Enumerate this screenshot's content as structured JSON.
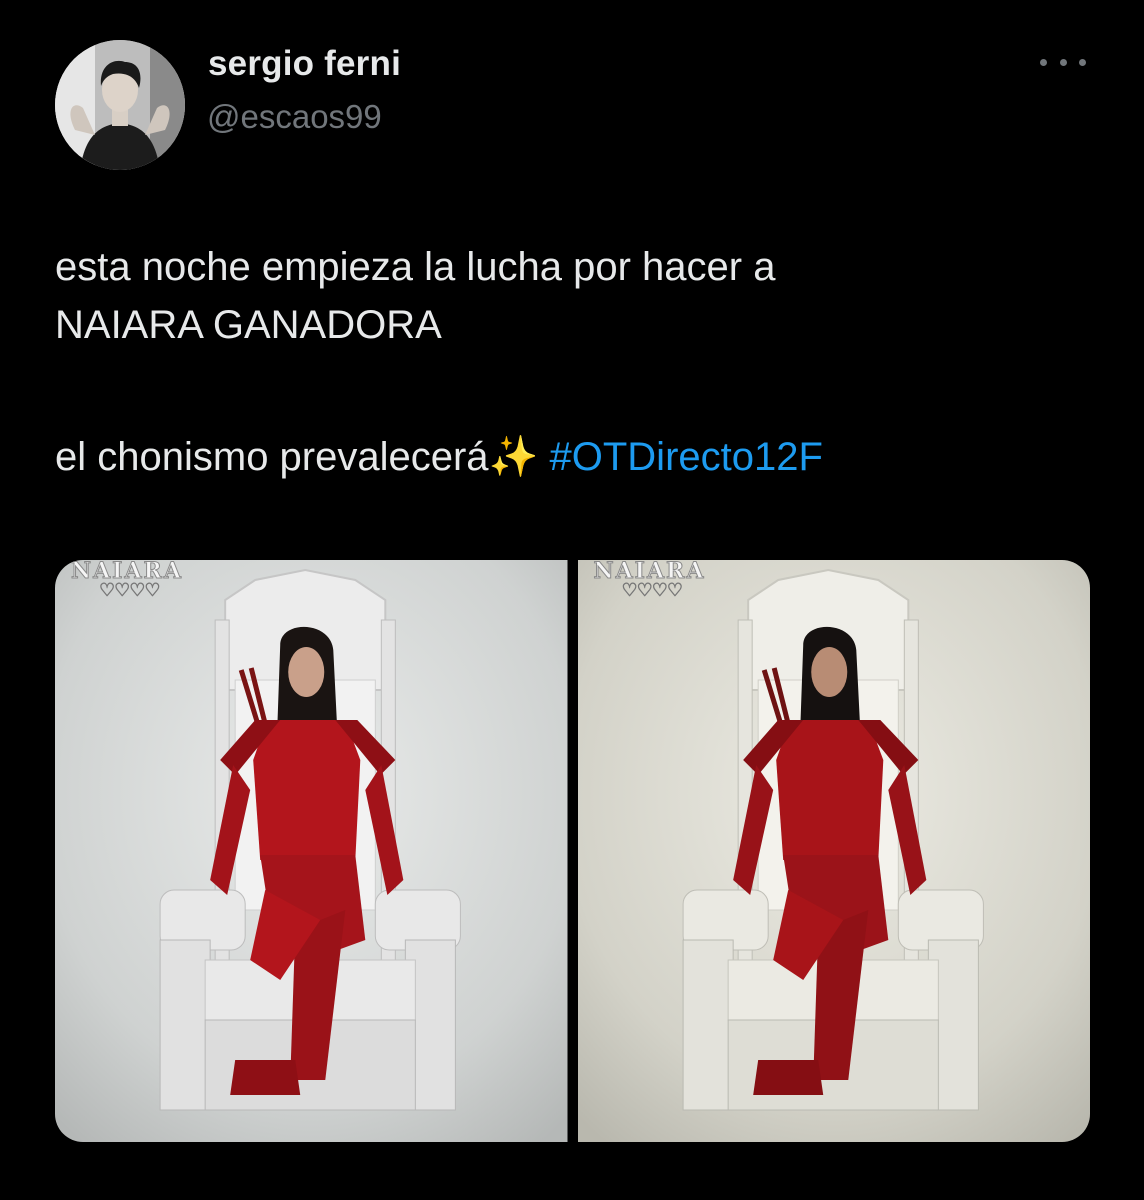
{
  "tweet": {
    "author": {
      "display_name": "sergio ferni",
      "handle": "@escaos99"
    },
    "more_icon": "more-horizontal-icon",
    "text": {
      "line1": "esta noche empieza la lucha por hacer a",
      "line2": "NAIARA GANADORA",
      "line3": "el chonismo prevalecerá",
      "sparkle": "✨",
      "hashtag": "#OTDirecto12F"
    },
    "media": [
      {
        "title": "NAIARA",
        "hearts": "♡♡♡♡"
      },
      {
        "title": "NAIARA",
        "hearts": "♡♡♡♡"
      }
    ]
  },
  "colors": {
    "background": "#000000",
    "text": "#e7e9ea",
    "secondary_text": "#71767b",
    "link": "#1d9bf0",
    "costume_red": "#b3151c"
  }
}
